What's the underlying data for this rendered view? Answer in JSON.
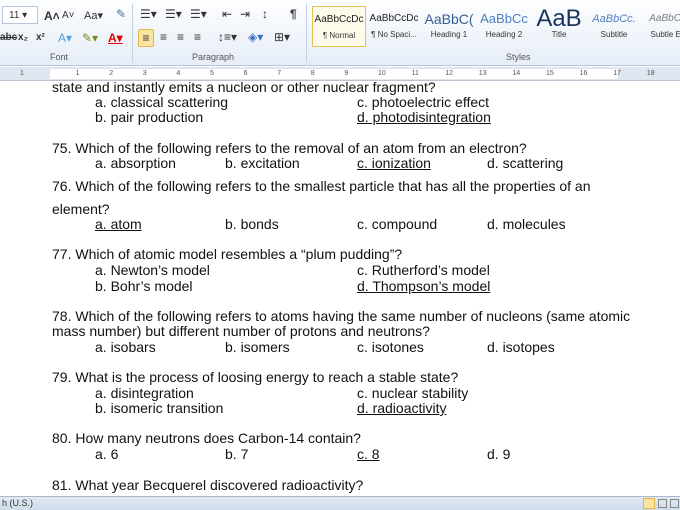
{
  "ribbon": {
    "font_size": "11",
    "groups": {
      "font": "Font",
      "paragraph": "Paragraph",
      "styles": "Styles"
    },
    "styles": [
      {
        "preview": "AaBbCcDc",
        "label": "¶ Normal",
        "color": "#222222",
        "selected": true
      },
      {
        "preview": "AaBbCcDc",
        "label": "¶ No Spaci...",
        "color": "#222222"
      },
      {
        "preview": "AaBbC(",
        "label": "Heading 1",
        "color": "#365f91"
      },
      {
        "preview": "AaBbCc",
        "label": "Heading 2",
        "color": "#4f81bd"
      },
      {
        "preview": "AaB",
        "label": "Title",
        "color": "#17365d"
      },
      {
        "preview": "AaBbCc.",
        "label": "Subtitle",
        "color": "#4f81bd"
      },
      {
        "preview": "AaBbCcI",
        "label": "Subtle Em",
        "color": "#7f7f7f"
      }
    ]
  },
  "ruler": {
    "numbers": [
      "1",
      "1",
      "2",
      "3",
      "4",
      "5",
      "6",
      "7",
      "8",
      "9",
      "10",
      "11",
      "12",
      "13",
      "14",
      "15",
      "16",
      "17",
      "18"
    ]
  },
  "document": {
    "lines": [
      {
        "text": "state and instantly emits a nucleon or other nuclear fragment?",
        "col": 0,
        "row": 0
      },
      {
        "text": "a. classical scattering",
        "col": 1,
        "row": 1
      },
      {
        "text": "c. photoelectric effect",
        "col": 3,
        "row": 1
      },
      {
        "text": "b. pair production",
        "col": 1,
        "row": 2
      },
      {
        "text": "d. photodisintegration",
        "col": 3,
        "row": 2,
        "answer": true
      },
      {
        "text": "75. Which of the following refers to the removal of an atom from an electron?",
        "col": 0,
        "row": 3
      },
      {
        "text": "a. absorption",
        "col": 1,
        "row": 4
      },
      {
        "text": "b. excitation",
        "col": 2,
        "row": 4
      },
      {
        "text": "c. ionization",
        "col": 3,
        "row": 4,
        "answer": true
      },
      {
        "text": "d. scattering",
        "col": 4,
        "row": 4
      },
      {
        "text": "76. Which of the following refers to the smallest particle that has all the properties of an",
        "col": 0,
        "row": 5
      },
      {
        "text": "element?",
        "col": 0,
        "row": 6
      },
      {
        "text": "a. atom",
        "col": 1,
        "row": 7,
        "answer": true
      },
      {
        "text": "b. bonds",
        "col": 2,
        "row": 7
      },
      {
        "text": "c. compound",
        "col": 3,
        "row": 7
      },
      {
        "text": "d. molecules",
        "col": 4,
        "row": 7
      },
      {
        "text": "77. Which of atomic model resembles a “plum pudding”?",
        "col": 0,
        "row": 8
      },
      {
        "text": "a. Newton’s model",
        "col": 1,
        "row": 9
      },
      {
        "text": "c. Rutherford’s model",
        "col": 3,
        "row": 9
      },
      {
        "text": "b. Bohr’s model",
        "col": 1,
        "row": 10
      },
      {
        "text": "d. Thompson’s model",
        "col": 3,
        "row": 10,
        "answer": true
      },
      {
        "text": "78. Which of the following refers to atoms having the same number of nucleons (same atomic",
        "col": 0,
        "row": 11
      },
      {
        "text": "mass number) but different number of protons and neutrons?",
        "col": 0,
        "row": 12
      },
      {
        "text": "a. isobars",
        "col": 1,
        "row": 13
      },
      {
        "text": "b. isomers",
        "col": 2,
        "row": 13
      },
      {
        "text": "c. isotones",
        "col": 3,
        "row": 13
      },
      {
        "text": "d. isotopes",
        "col": 4,
        "row": 13
      },
      {
        "text": "79. What is the process of loosing energy to reach a stable state?",
        "col": 0,
        "row": 14
      },
      {
        "text": "a. disintegration",
        "col": 1,
        "row": 15
      },
      {
        "text": "c. nuclear stability",
        "col": 3,
        "row": 15
      },
      {
        "text": "b. isomeric transition",
        "col": 1,
        "row": 16
      },
      {
        "text": "d. radioactivity",
        "col": 3,
        "row": 16,
        "answer": true
      },
      {
        "text": "80. How many neutrons does Carbon-14 contain?",
        "col": 0,
        "row": 17
      },
      {
        "text": "a. 6",
        "col": 1,
        "row": 18
      },
      {
        "text": "b. 7",
        "col": 2,
        "row": 18
      },
      {
        "text": "c. 8",
        "col": 3,
        "row": 18,
        "answer": true
      },
      {
        "text": "d. 9",
        "col": 4,
        "row": 18
      },
      {
        "text": "81. What year Becquerel discovered radioactivity?",
        "col": 0,
        "row": 19
      }
    ]
  },
  "status": {
    "language": "h (U.S.)"
  }
}
